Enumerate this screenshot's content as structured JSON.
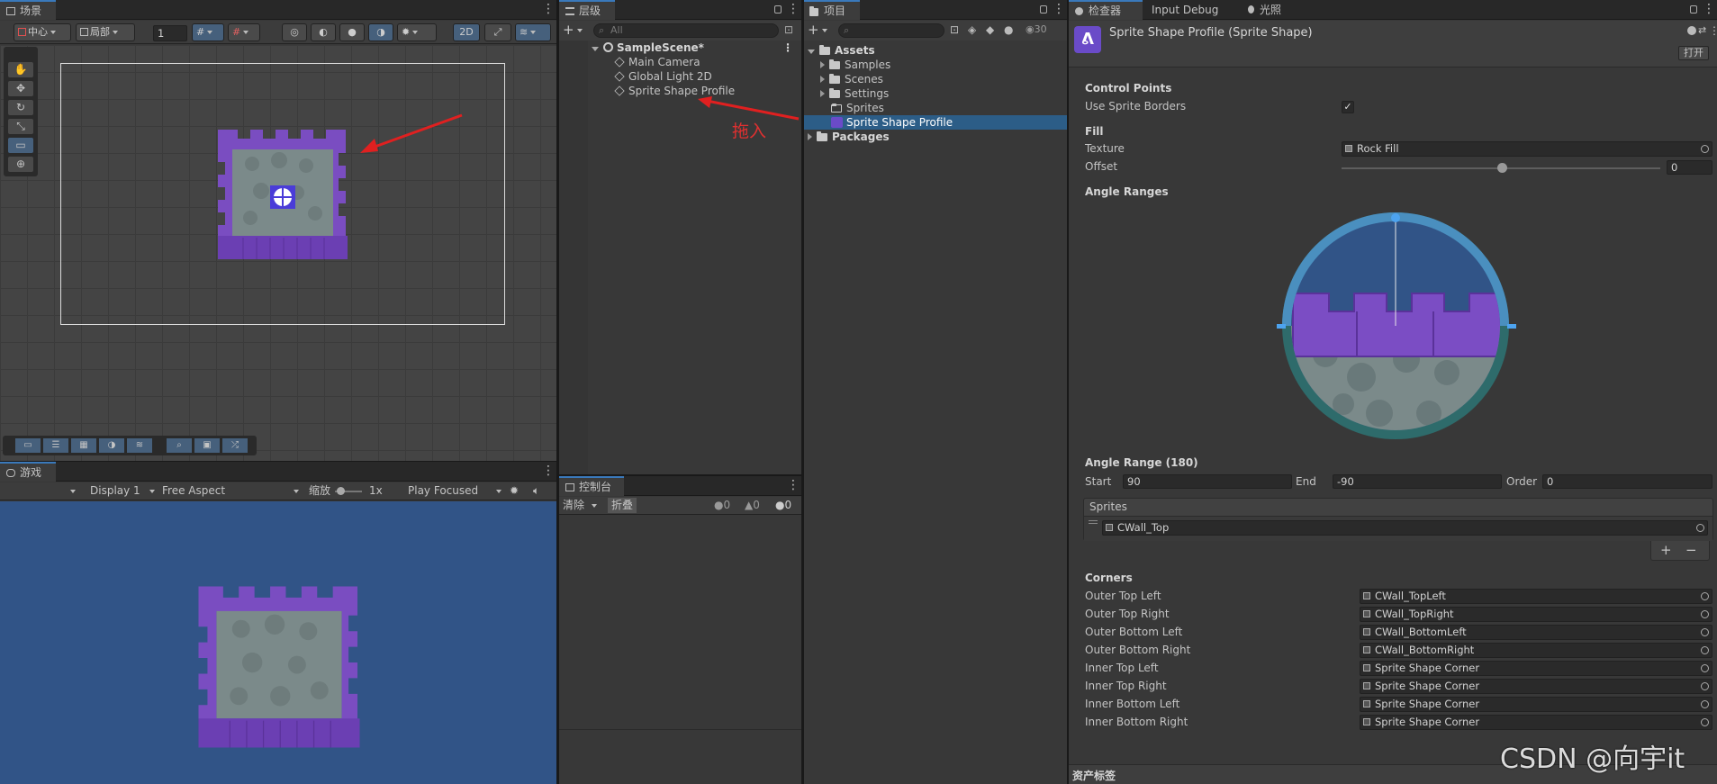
{
  "scene": {
    "tab": "场景",
    "pivot": "中心",
    "space": "局部",
    "grid_value": "1",
    "mode_2d": "2D"
  },
  "game": {
    "tab": "游戏",
    "display": "Display 1",
    "aspect": "Free Aspect",
    "scale_label": "缩放",
    "scale_value": "1x",
    "play_mode": "Play Focused"
  },
  "hierarchy": {
    "tab": "层级",
    "search_placeholder": "All",
    "scene_name": "SampleScene*",
    "items": [
      "Main Camera",
      "Global Light 2D",
      "Sprite Shape Profile"
    ],
    "annotation": "拖入"
  },
  "console": {
    "tab": "控制台",
    "clear": "清除",
    "collapse": "折叠",
    "counts": [
      "0",
      "0",
      "0"
    ]
  },
  "project": {
    "tab": "项目",
    "count": "30",
    "assets": "Assets",
    "folders": [
      "Samples",
      "Scenes",
      "Settings",
      "Sprites"
    ],
    "selected": "Sprite Shape Profile",
    "packages": "Packages"
  },
  "inspector": {
    "tabs": [
      "检查器",
      "Input Debug",
      "光照"
    ],
    "title": "Sprite Shape Profile (Sprite Shape)",
    "open_button": "打开",
    "control_points": "Control Points",
    "use_sprite_borders": "Use Sprite Borders",
    "fill": "Fill",
    "texture_label": "Texture",
    "texture_value": "Rock Fill",
    "offset_label": "Offset",
    "offset_value": "0",
    "angle_ranges": "Angle Ranges",
    "angle_range_title": "Angle Range (180)",
    "start_label": "Start",
    "start_value": "90",
    "end_label": "End",
    "end_value": "-90",
    "order_label": "Order",
    "order_value": "0",
    "sprites_header": "Sprites",
    "sprite_item": "CWall_Top",
    "corners": "Corners",
    "corner_rows": [
      {
        "label": "Outer Top Left",
        "value": "CWall_TopLeft"
      },
      {
        "label": "Outer Top Right",
        "value": "CWall_TopRight"
      },
      {
        "label": "Outer Bottom Left",
        "value": "CWall_BottomLeft"
      },
      {
        "label": "Outer Bottom Right",
        "value": "CWall_BottomRight"
      },
      {
        "label": "Inner Top Left",
        "value": "Sprite Shape Corner"
      },
      {
        "label": "Inner Top Right",
        "value": "Sprite Shape Corner"
      },
      {
        "label": "Inner Bottom Left",
        "value": "Sprite Shape Corner"
      },
      {
        "label": "Inner Bottom Right",
        "value": "Sprite Shape Corner"
      }
    ],
    "asset_labels": "资产标签"
  },
  "watermark": "CSDN @向宇it"
}
